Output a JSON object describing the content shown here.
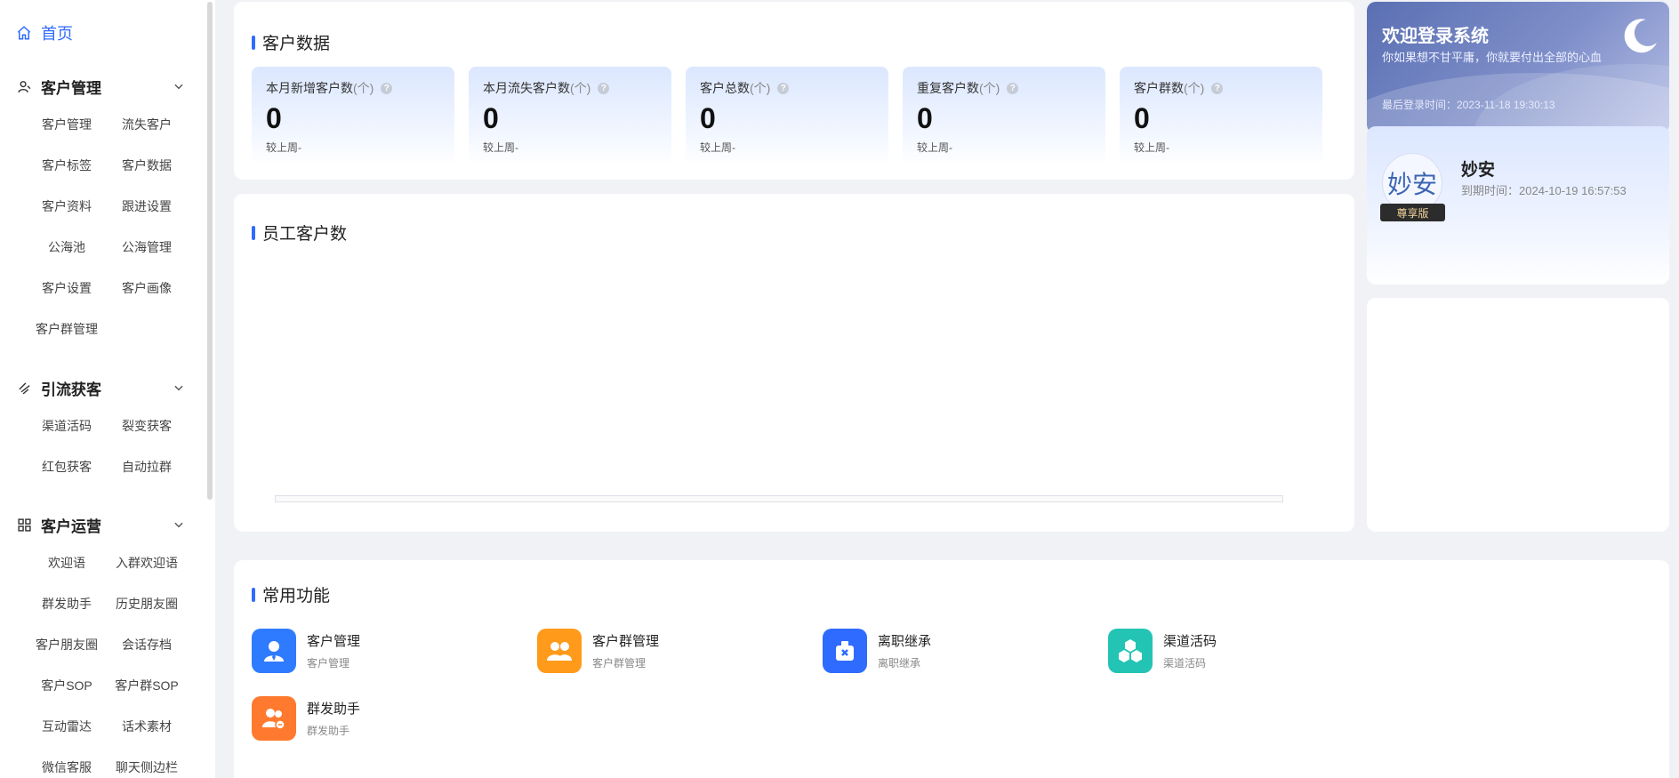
{
  "sidebar": {
    "home_label": "首页",
    "sections": [
      {
        "title": "客户管理",
        "items": [
          "客户管理",
          "流失客户",
          "客户标签",
          "客户数据",
          "客户资料",
          "跟进设置",
          "公海池",
          "公海管理",
          "客户设置",
          "客户画像",
          "客户群管理"
        ]
      },
      {
        "title": "引流获客",
        "items": [
          "渠道活码",
          "裂变获客",
          "红包获客",
          "自动拉群"
        ]
      },
      {
        "title": "客户运营",
        "items": [
          "欢迎语",
          "入群欢迎语",
          "群发助手",
          "历史朋友圈",
          "客户朋友圈",
          "会话存档",
          "客户SOP",
          "客户群SOP",
          "互动雷达",
          "话术素材",
          "微信客服",
          "聊天侧边栏"
        ]
      }
    ]
  },
  "customer_data": {
    "title": "客户数据",
    "stats": [
      {
        "label": "本月新增客户数",
        "unit": "(个)",
        "value": "0",
        "compare": "较上周-"
      },
      {
        "label": "本月流失客户数",
        "unit": "(个)",
        "value": "0",
        "compare": "较上周-"
      },
      {
        "label": "客户总数",
        "unit": "(个)",
        "value": "0",
        "compare": "较上周-"
      },
      {
        "label": "重复客户数",
        "unit": "(个)",
        "value": "0",
        "compare": "较上周-"
      },
      {
        "label": "客户群数",
        "unit": "(个)",
        "value": "0",
        "compare": "较上周-"
      }
    ]
  },
  "staff_chart": {
    "title": "员工客户数"
  },
  "welcome": {
    "title": "欢迎登录系统",
    "subtitle": "你如果想不甘平庸，你就要付出全部的心血",
    "last_login": "最后登录时间：2023-11-18 19:30:13"
  },
  "profile": {
    "avatar_text": "妙安",
    "badge": "尊享版",
    "name": "妙安",
    "expire": "到期时间：2024-10-19 16:57:53"
  },
  "common_functions": {
    "title": "常用功能",
    "items": [
      {
        "title": "客户管理",
        "desc": "客户管理",
        "icon": "customer-manage-icon",
        "color": "#2f7bff"
      },
      {
        "title": "客户群管理",
        "desc": "客户群管理",
        "icon": "group-manage-icon",
        "color": "#ff9a1a"
      },
      {
        "title": "离职继承",
        "desc": "离职继承",
        "icon": "resign-inherit-icon",
        "color": "#2f6bff"
      },
      {
        "title": "渠道活码",
        "desc": "渠道活码",
        "icon": "channel-qrcode-icon",
        "color": "#23c4b4"
      },
      {
        "title": "群发助手",
        "desc": "群发助手",
        "icon": "mass-send-icon",
        "color": "#ff7a2e"
      }
    ]
  }
}
